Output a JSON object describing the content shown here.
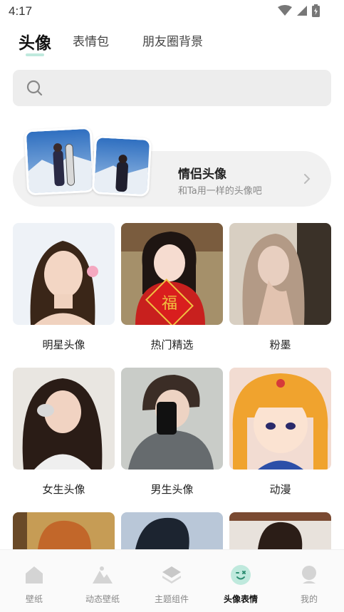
{
  "status_bar": {
    "time": "4:17"
  },
  "tabs": [
    {
      "label": "头像",
      "active": true
    },
    {
      "label": "表情包",
      "active": false
    },
    {
      "label": "朋友圈背景",
      "active": false
    }
  ],
  "search": {
    "placeholder": ""
  },
  "couple": {
    "title": "情侣头像",
    "subtitle": "和Ta用一样的头像吧"
  },
  "categories": [
    {
      "label": "明星头像"
    },
    {
      "label": "热门精选"
    },
    {
      "label": "粉墨"
    },
    {
      "label": "女生头像"
    },
    {
      "label": "男生头像"
    },
    {
      "label": "动漫"
    }
  ],
  "bottom_nav": [
    {
      "label": "壁纸",
      "icon": "house-icon"
    },
    {
      "label": "动态壁纸",
      "icon": "mountain-icon"
    },
    {
      "label": "主题组件",
      "icon": "layers-icon"
    },
    {
      "label": "头像表情",
      "icon": "smiley-icon",
      "active": true
    },
    {
      "label": "我的",
      "icon": "profile-icon"
    }
  ],
  "colors": {
    "accent": "#bfe9dd",
    "accent_dark": "#2e8f73"
  }
}
